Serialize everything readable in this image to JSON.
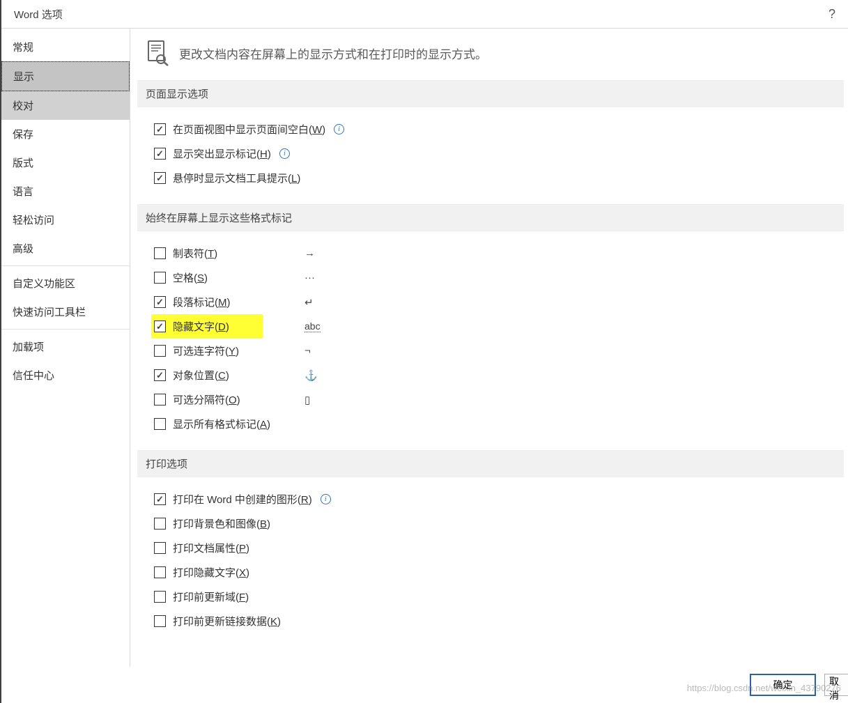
{
  "title": "Word 选项",
  "help_tooltip": "?",
  "sidebar": {
    "items": [
      {
        "label": "常规",
        "state": ""
      },
      {
        "label": "显示",
        "state": "selected"
      },
      {
        "label": "校对",
        "state": "highlighted"
      },
      {
        "label": "保存",
        "state": ""
      },
      {
        "label": "版式",
        "state": ""
      },
      {
        "label": "语言",
        "state": ""
      },
      {
        "label": "轻松访问",
        "state": ""
      },
      {
        "label": "高级",
        "state": ""
      },
      {
        "label": "自定义功能区",
        "state": ""
      },
      {
        "label": "快速访问工具栏",
        "state": ""
      },
      {
        "label": "加载项",
        "state": ""
      },
      {
        "label": "信任中心",
        "state": ""
      }
    ]
  },
  "header_text": "更改文档内容在屏幕上的显示方式和在打印时的显示方式。",
  "sections": {
    "page_display": {
      "title": "页面显示选项",
      "options": [
        {
          "checked": true,
          "label": "在页面视图中显示页面间空白(",
          "accel": "W",
          "suffix": ")",
          "info": true
        },
        {
          "checked": true,
          "label": "显示突出显示标记(",
          "accel": "H",
          "suffix": ")",
          "info": true
        },
        {
          "checked": true,
          "label": "悬停时显示文档工具提示(",
          "accel": "L",
          "suffix": ")",
          "info": false
        }
      ]
    },
    "format_marks": {
      "title": "始终在屏幕上显示这些格式标记",
      "options": [
        {
          "checked": false,
          "label": "制表符(",
          "accel": "T",
          "suffix": ")",
          "symbol": "→"
        },
        {
          "checked": false,
          "label": "空格(",
          "accel": "S",
          "suffix": ")",
          "symbol": "···"
        },
        {
          "checked": true,
          "label": "段落标记(",
          "accel": "M",
          "suffix": ")",
          "symbol": "↵"
        },
        {
          "checked": true,
          "label": "隐藏文字(",
          "accel": "D",
          "suffix": ")",
          "symbol": "abc",
          "highlight": true,
          "abc": true
        },
        {
          "checked": false,
          "label": "可选连字符(",
          "accel": "Y",
          "suffix": ")",
          "symbol": "¬"
        },
        {
          "checked": true,
          "label": "对象位置(",
          "accel": "C",
          "suffix": ")",
          "symbol": "⚓"
        },
        {
          "checked": false,
          "label": "可选分隔符(",
          "accel": "O",
          "suffix": ")",
          "symbol": "▯"
        },
        {
          "checked": false,
          "label": "显示所有格式标记(",
          "accel": "A",
          "suffix": ")",
          "symbol": ""
        }
      ]
    },
    "print": {
      "title": "打印选项",
      "options": [
        {
          "checked": true,
          "label": "打印在 Word 中创建的图形(",
          "accel": "R",
          "suffix": ")",
          "info": true
        },
        {
          "checked": false,
          "label": "打印背景色和图像(",
          "accel": "B",
          "suffix": ")"
        },
        {
          "checked": false,
          "label": "打印文档属性(",
          "accel": "P",
          "suffix": ")"
        },
        {
          "checked": false,
          "label": "打印隐藏文字(",
          "accel": "X",
          "suffix": ")"
        },
        {
          "checked": false,
          "label": "打印前更新域(",
          "accel": "F",
          "suffix": ")"
        },
        {
          "checked": false,
          "label": "打印前更新链接数据(",
          "accel": "K",
          "suffix": ")"
        }
      ]
    }
  },
  "footer": {
    "ok": "确定",
    "cancel": "取消"
  },
  "watermark": "https://blog.csdn.net/weixin_43790276"
}
